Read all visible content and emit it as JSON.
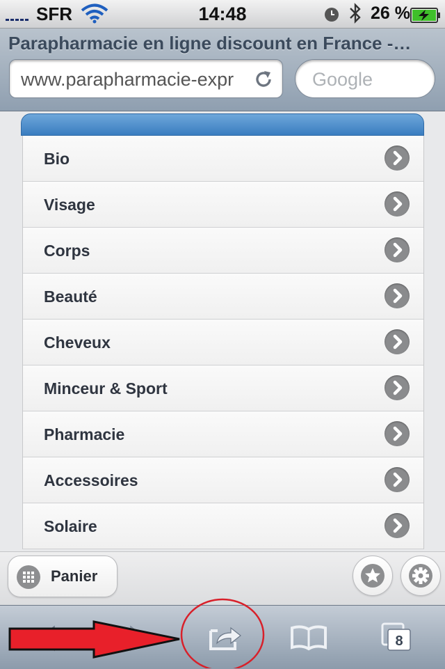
{
  "status_bar": {
    "carrier": "SFR",
    "time": "14:48",
    "battery_percent": "26 %"
  },
  "browser": {
    "page_title": "Parapharmacie en ligne discount en France -…",
    "url": "www.parapharmacie-expr",
    "search_placeholder": "Google",
    "open_tabs": "8"
  },
  "menu": {
    "items": [
      {
        "label": "Bio"
      },
      {
        "label": "Visage"
      },
      {
        "label": "Corps"
      },
      {
        "label": "Beauté"
      },
      {
        "label": "Cheveux"
      },
      {
        "label": "Minceur & Sport"
      },
      {
        "label": "Pharmacie"
      },
      {
        "label": "Accessoires"
      },
      {
        "label": "Solaire"
      }
    ]
  },
  "footer": {
    "cart_label": "Panier"
  },
  "colors": {
    "header_blue": "#3a7dc0",
    "annotation_red": "#e8202a"
  }
}
